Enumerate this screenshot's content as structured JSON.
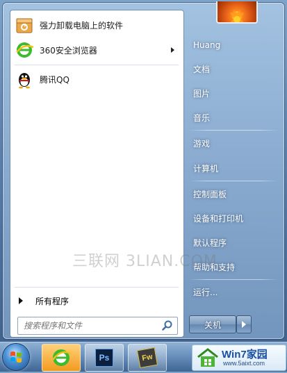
{
  "left_pane": {
    "pinned": [
      {
        "label": "强力卸载电脑上的软件",
        "icon": "uninstall-box-icon"
      },
      {
        "label": "360安全浏览器",
        "icon": "360-browser-icon",
        "has_submenu": true
      }
    ],
    "recent": [
      {
        "label": "腾讯QQ",
        "icon": "qq-penguin-icon"
      }
    ],
    "all_programs_label": "所有程序",
    "search": {
      "placeholder": "搜索程序和文件"
    }
  },
  "right_pane": {
    "items": [
      {
        "label": "Huang"
      },
      {
        "label": "文档"
      },
      {
        "label": "图片"
      },
      {
        "label": "音乐"
      },
      {
        "label": "游戏"
      },
      {
        "label": "计算机"
      },
      {
        "label": "控制面板"
      },
      {
        "label": "设备和打印机"
      },
      {
        "label": "默认程序"
      },
      {
        "label": "帮助和支持"
      },
      {
        "label": "运行..."
      }
    ],
    "shutdown_label": "关机"
  },
  "watermark": "三联网 3LIAN.COM",
  "taskbar": {
    "apps": [
      "360-browser-icon",
      "photoshop-icon",
      "fireworks-icon"
    ],
    "ps_label": "Ps",
    "fw_label": "Fw"
  },
  "logo": {
    "title": "Win7家园",
    "url": "www.5aixt.com"
  }
}
